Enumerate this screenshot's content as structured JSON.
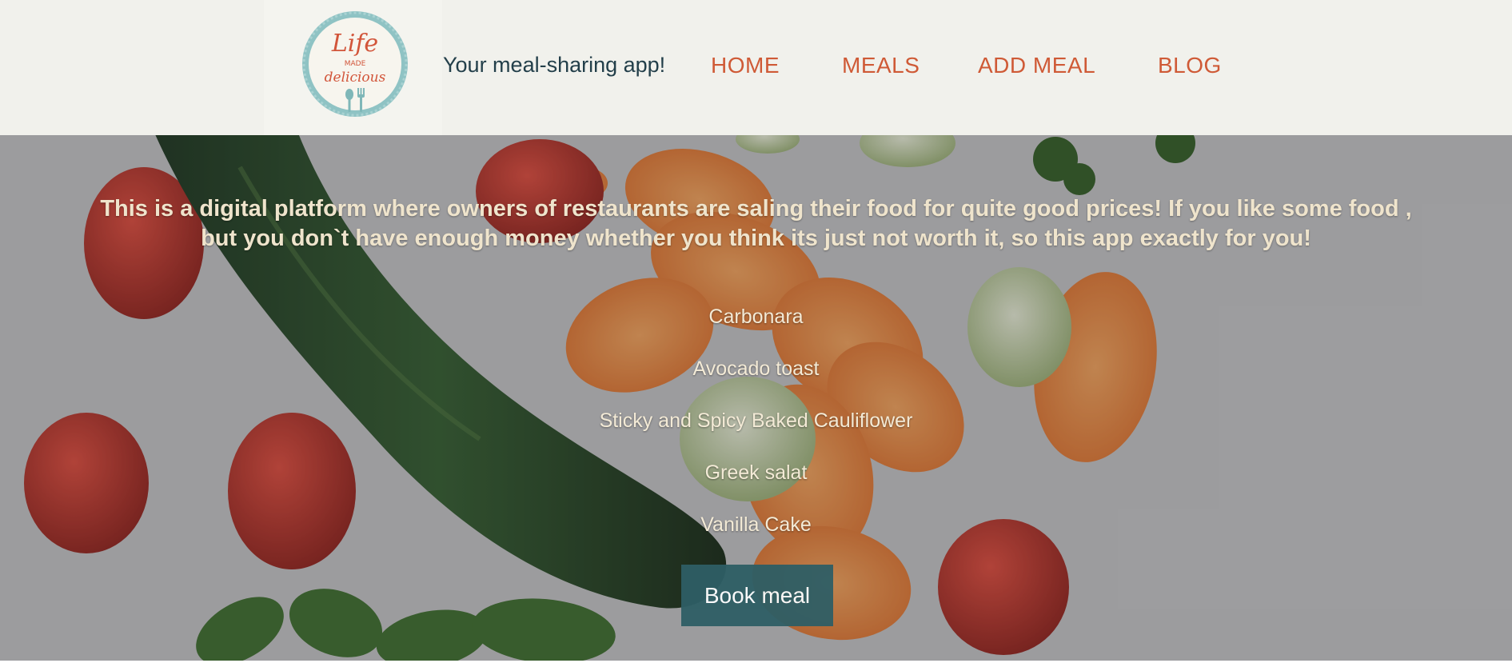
{
  "header": {
    "logo": {
      "line1": "Life",
      "line2": "MADE",
      "line3": "delicious"
    },
    "tagline": "Your meal-sharing app!",
    "nav": [
      {
        "label": "HOME"
      },
      {
        "label": "MEALS"
      },
      {
        "label": "ADD MEAL"
      },
      {
        "label": "BLOG"
      }
    ]
  },
  "hero": {
    "intro_line1": "This is a digital platform where owners of restaurants are saling their food for quite good prices! If you like some food ,",
    "intro_line2": "but you don`t have enough money whether you think its just not worth it, so this app exactly for you!",
    "meals": [
      "Carbonara",
      "Avocado toast",
      "Sticky and Spicy Baked Cauliflower",
      "Greek salat",
      "Vanilla Cake"
    ],
    "book_button": "Book meal"
  },
  "colors": {
    "header_bg": "#f1f1ec",
    "nav_link": "#cf5a36",
    "tagline": "#233f4a",
    "button_bg": "#2e5e65",
    "logo_ring": "#8fc3c4"
  }
}
